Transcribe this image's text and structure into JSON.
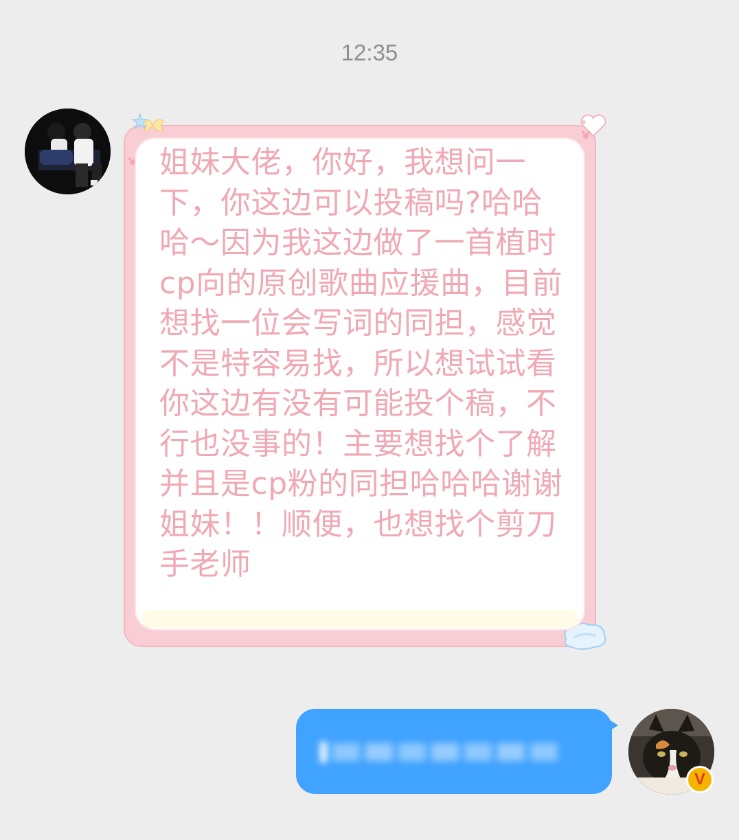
{
  "chat": {
    "timestamp": "12:35",
    "incoming": {
      "text": "姐妹大佬，你好，我想问一下，你这边可以投稿吗?哈哈哈～因为我这边做了一首植时cp向的原创歌曲应援曲，目前想找一位会写词的同担，感觉不是特容易找，所以想试试看你这边有没有可能投个稿，不行也没事的！主要想找个了解并且是cp粉的同担哈哈哈谢谢姐妹！！顺便，也想找个剪刀手老师"
    },
    "outgoing": {
      "text": ""
    },
    "colors": {
      "background": "#ededed",
      "incoming_text": "#f0a9b4",
      "incoming_frame": "#f9cdd4",
      "outgoing_bubble": "#40a3ff"
    },
    "icons": {
      "sender_avatar": "avatar-photo",
      "self_avatar": "cat-avatar",
      "verified_badge": "verified-v-badge-icon"
    }
  }
}
